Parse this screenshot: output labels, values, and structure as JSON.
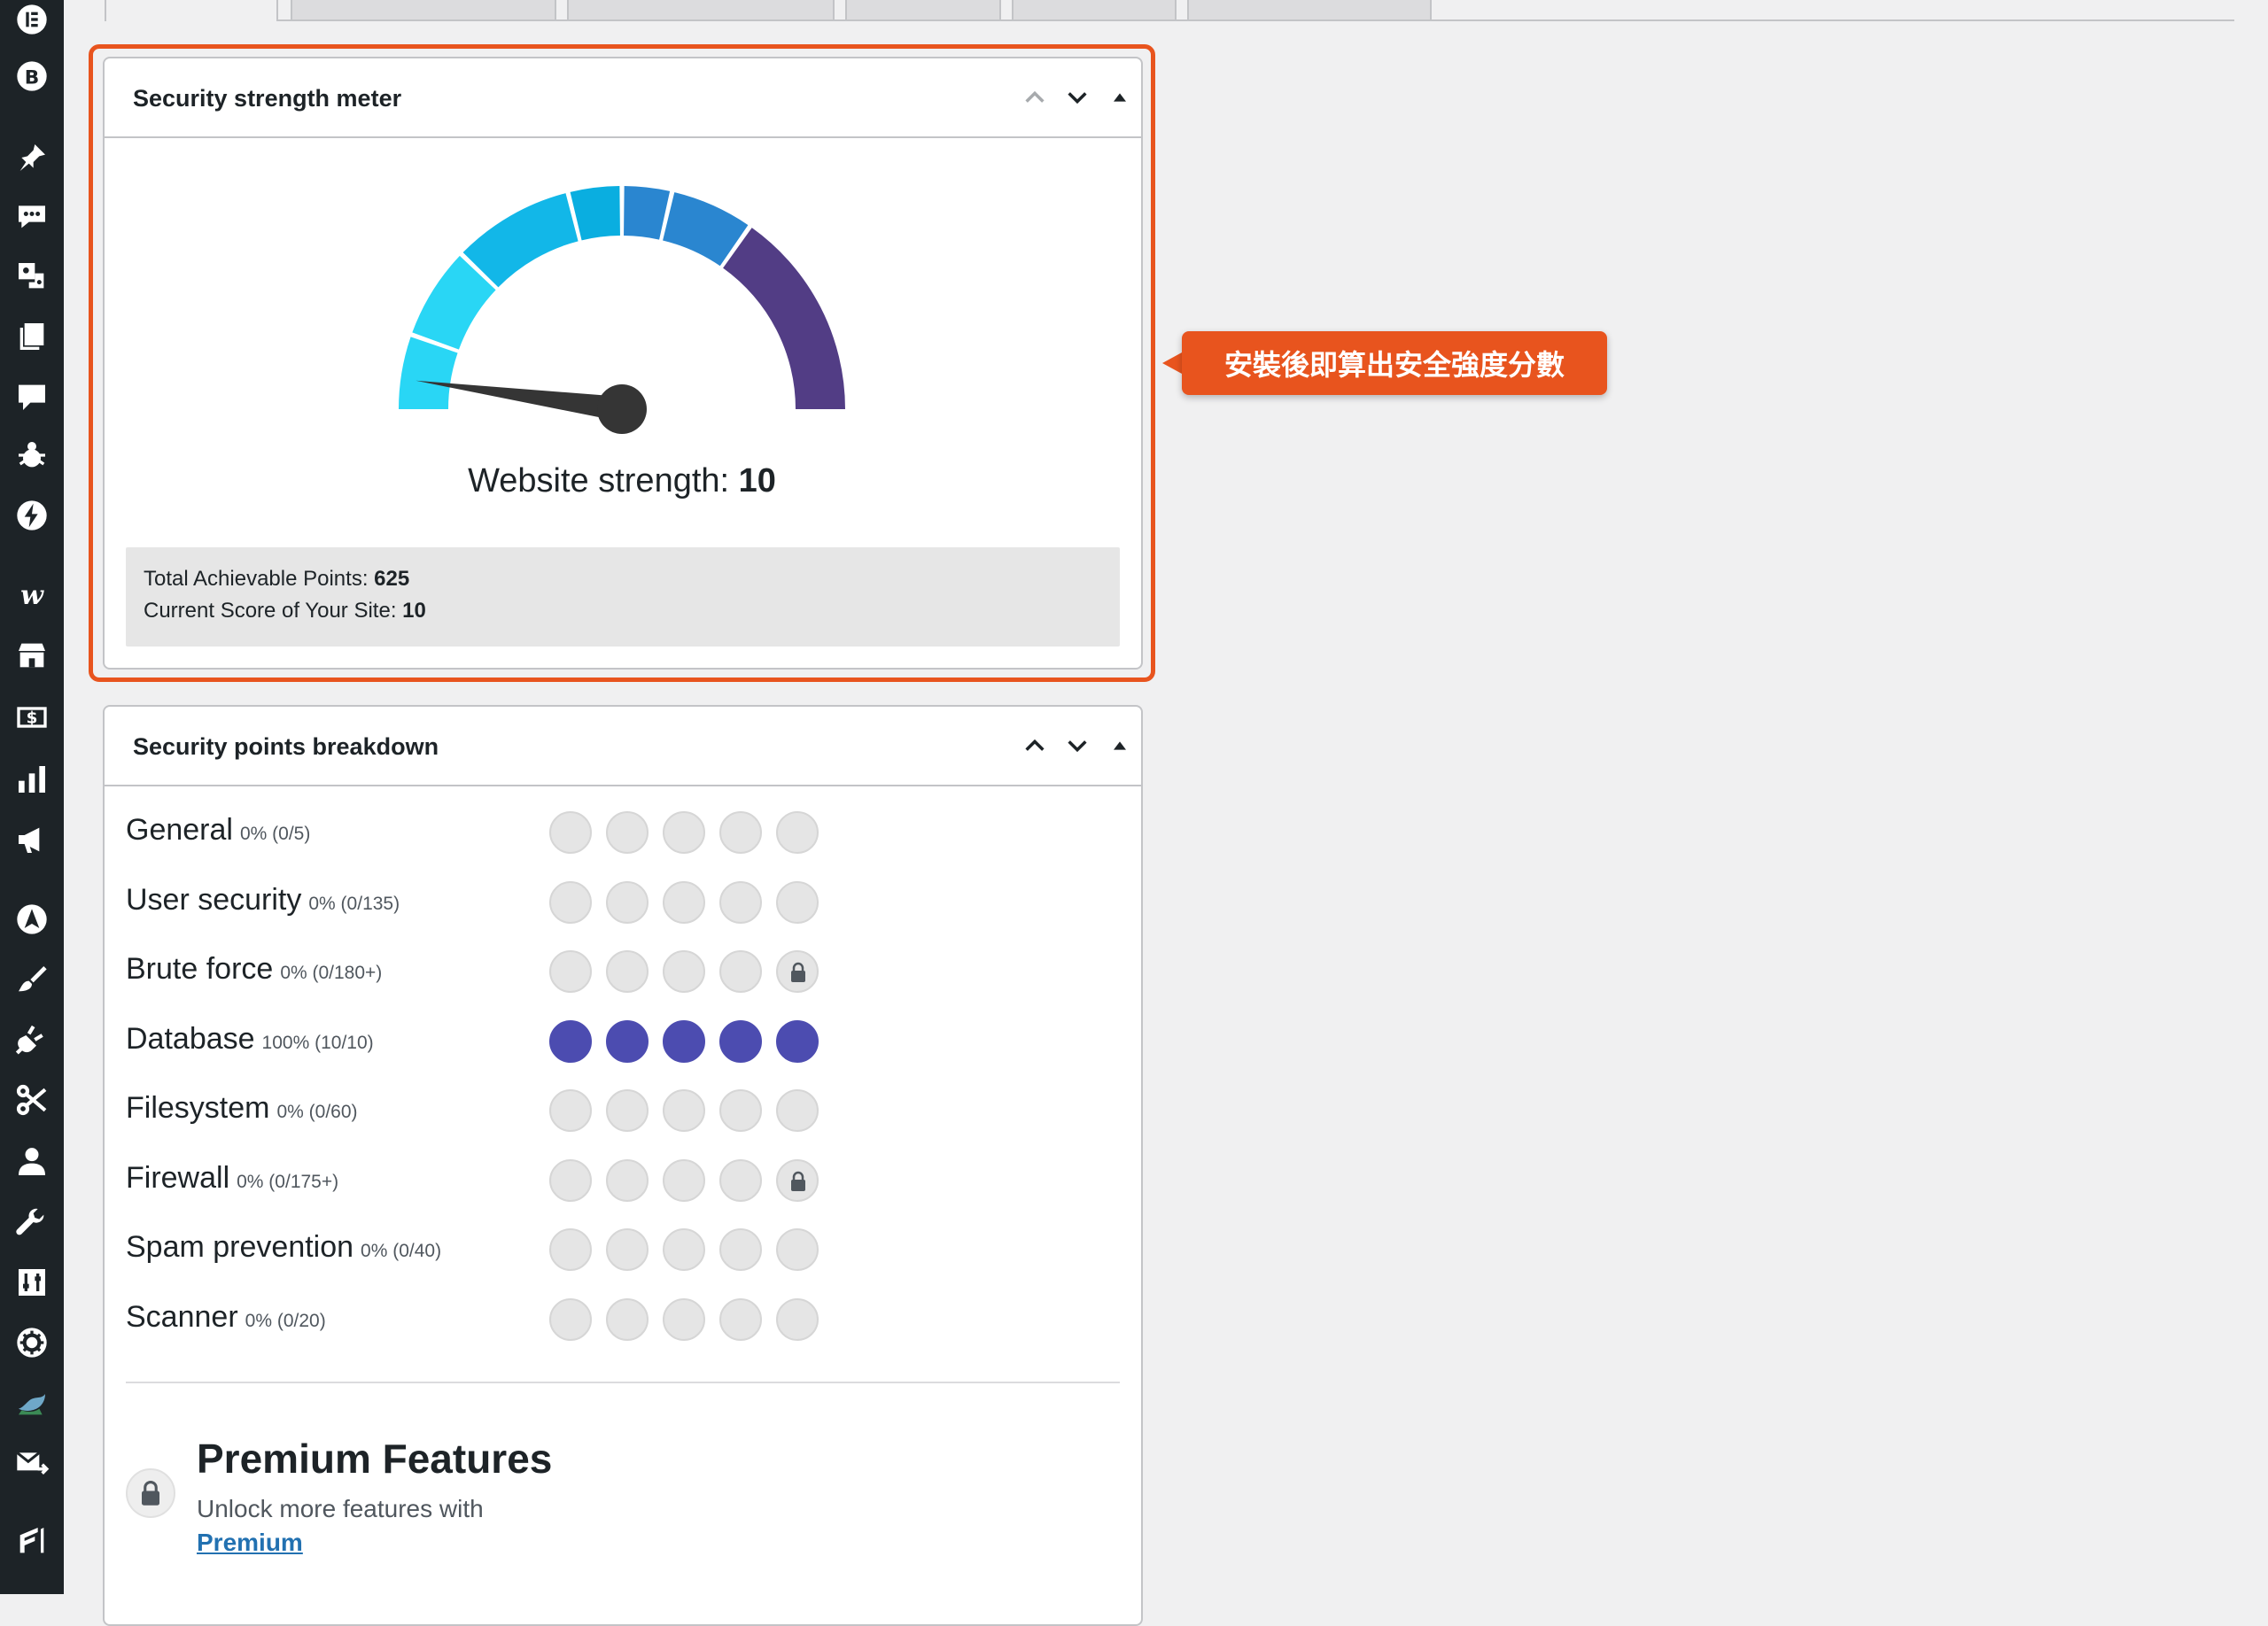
{
  "sidebar": {
    "icons": [
      "elementor-icon",
      "b-badge-icon",
      "pin-icon",
      "chat-icon",
      "media-icon",
      "pages-icon",
      "comment-icon",
      "bug-icon",
      "bolt-icon",
      "w-logo-icon",
      "store-icon",
      "dollar-icon",
      "analytics-icon",
      "megaphone-icon",
      "navigation-icon",
      "brush-icon",
      "plugin-icon",
      "scissors-icon",
      "user-icon",
      "wrench-icon",
      "settings-sliders-icon",
      "gear-icon",
      "bird-icon",
      "mail-icon",
      "forms-icon"
    ]
  },
  "meter_card": {
    "title": "Security strength meter",
    "strength_label": "Website strength: ",
    "strength_value": "10",
    "total_label": "Total Achievable Points: ",
    "total_value": "625",
    "current_label": "Current Score of Your Site: ",
    "current_value": "10",
    "score_fraction": 0.016
  },
  "callout": {
    "text": "安裝後即算出安全強度分數"
  },
  "breakdown_card": {
    "title": "Security points breakdown",
    "rows": [
      {
        "label": "General",
        "pct": "0% (0/5)",
        "filled": 0,
        "locked": false
      },
      {
        "label": "User security",
        "pct": "0% (0/135)",
        "filled": 0,
        "locked": false
      },
      {
        "label": "Brute force",
        "pct": "0% (0/180+)",
        "filled": 0,
        "locked": true
      },
      {
        "label": "Database",
        "pct": "100% (10/10)",
        "filled": 5,
        "locked": false
      },
      {
        "label": "Filesystem",
        "pct": "0% (0/60)",
        "filled": 0,
        "locked": false
      },
      {
        "label": "Firewall",
        "pct": "0% (0/175+)",
        "filled": 0,
        "locked": true
      },
      {
        "label": "Spam prevention",
        "pct": "0% (0/40)",
        "filled": 0,
        "locked": false
      },
      {
        "label": "Scanner",
        "pct": "0% (0/20)",
        "filled": 0,
        "locked": false
      }
    ],
    "premium": {
      "title": "Premium Features",
      "text": "Unlock more features with",
      "link": "Premium"
    }
  },
  "colors": {
    "accent": "#e8541e",
    "filled_dot": "#4c4cb0",
    "gauge": [
      "#29d6f5",
      "#29d6f5",
      "#12b7e8",
      "#0aaee0",
      "#2a86d0",
      "#2a86d0",
      "#523d85"
    ]
  }
}
